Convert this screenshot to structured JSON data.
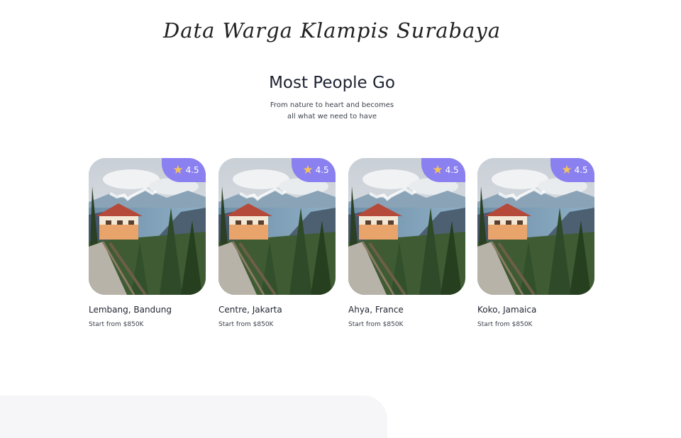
{
  "header": {
    "brand": "Data Warga Klampis Surabaya"
  },
  "section": {
    "title": "Most People Go",
    "subtitle_line1": "From nature to heart and becomes",
    "subtitle_line2": "all what we need to have"
  },
  "cards": [
    {
      "title": "Lembang, Bandung",
      "price": "Start from $850K",
      "rating": "4.5",
      "icon": "star-icon"
    },
    {
      "title": "Centre, Jakarta",
      "price": "Start from $850K",
      "rating": "4.5",
      "icon": "star-icon"
    },
    {
      "title": "Ahya, France",
      "price": "Start from $850K",
      "rating": "4.5",
      "icon": "star-icon"
    },
    {
      "title": "Koko, Jamaica",
      "price": "Start from $850K",
      "rating": "4.5",
      "icon": "star-icon"
    }
  ],
  "colors": {
    "rating_badge": "#8b80f0",
    "star": "#f5c25a",
    "panel": "#f6f6f8"
  }
}
